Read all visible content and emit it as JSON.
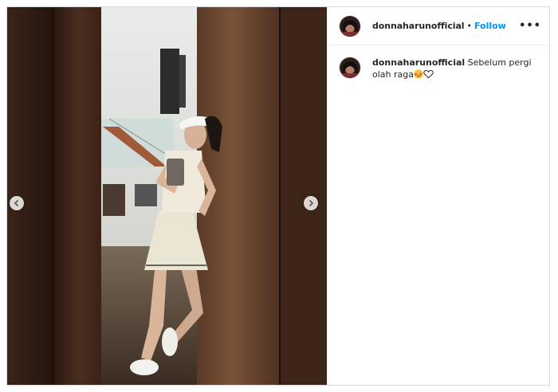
{
  "post": {
    "username": "donnaharunofficial",
    "dot": "•",
    "follow_label": "Follow",
    "more_label": "•••",
    "caption_username": "donnaharunofficial",
    "caption_text": "Sebelum pergi olah raga",
    "caption_emojis": [
      "star-struck-emoji",
      "white-heart-emoji"
    ]
  },
  "colors": {
    "follow_blue": "#0095f6",
    "text": "#262626",
    "border": "#dbdbdb"
  },
  "media": {
    "alt": "Woman in white tennis outfit taking a mirror selfie in a wood-paneled doorway"
  }
}
